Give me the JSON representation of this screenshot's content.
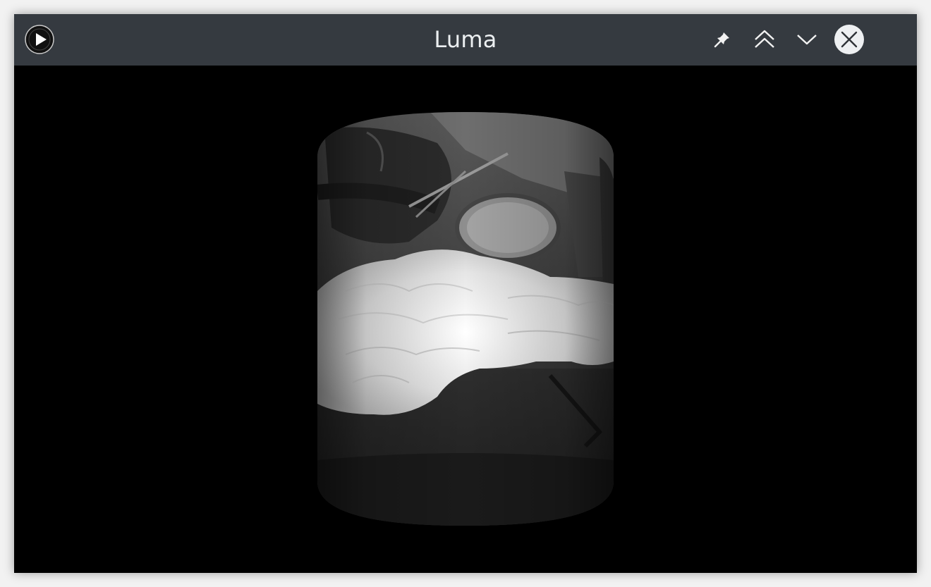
{
  "window": {
    "title": "Luma"
  },
  "titlebar": {
    "app_icon": "media-player-icon",
    "buttons": [
      {
        "name": "pin",
        "icon": "pin-icon"
      },
      {
        "name": "keep-above",
        "icon": "double-chevron-up-icon"
      },
      {
        "name": "minimize",
        "icon": "chevron-down-icon"
      },
      {
        "name": "close",
        "icon": "close-icon"
      }
    ]
  },
  "video": {
    "description_icon": "cylinder-video-frame"
  },
  "colors": {
    "titlebar": "#353a40",
    "title_text": "#eceff1",
    "content_background": "#000000",
    "close_button_bg": "#eef0f2"
  }
}
